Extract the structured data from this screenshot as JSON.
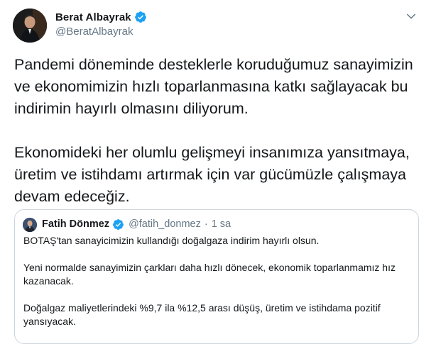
{
  "author": {
    "display_name": "Berat Albayrak",
    "handle": "@BeratAlbayrak"
  },
  "tweet": {
    "paragraphs": [
      "Pandemi döneminde desteklerle koruduğumuz sanayimizin ve ekonomimizin hızlı toparlanmasına katkı sağlayacak bu indirimin hayırlı olmasını diliyorum.",
      "Ekonomideki her olumlu gelişmeyi insanımıza yansıtmaya, üretim ve istihdamı artırmak için var gücümüzle çalışmaya devam edeceğiz."
    ]
  },
  "quoted_tweet": {
    "display_name": "Fatih Dönmez",
    "handle": "@fatih_donmez",
    "separator": "·",
    "time": "1 sa",
    "paragraphs": [
      "BOTAŞ'tan sanayicimizin kullandığı doğalgaza indirim hayırlı olsun.",
      "Yeni normalde sanayimizin çarkları daha hızlı dönecek, ekonomik toparlanmamız hız kazanacak.",
      "Doğalgaz maliyetlerindeki %9,7 ila %12,5 arası düşüş, üretim ve istihdama pozitif yansıyacak."
    ]
  },
  "icons": {
    "verified": "verified-badge-icon",
    "caret": "chevron-down-icon"
  },
  "colors": {
    "verified_blue": "#1da1f2",
    "secondary_text": "#657786",
    "primary_text": "#14171a",
    "border": "#ccd6dd"
  }
}
